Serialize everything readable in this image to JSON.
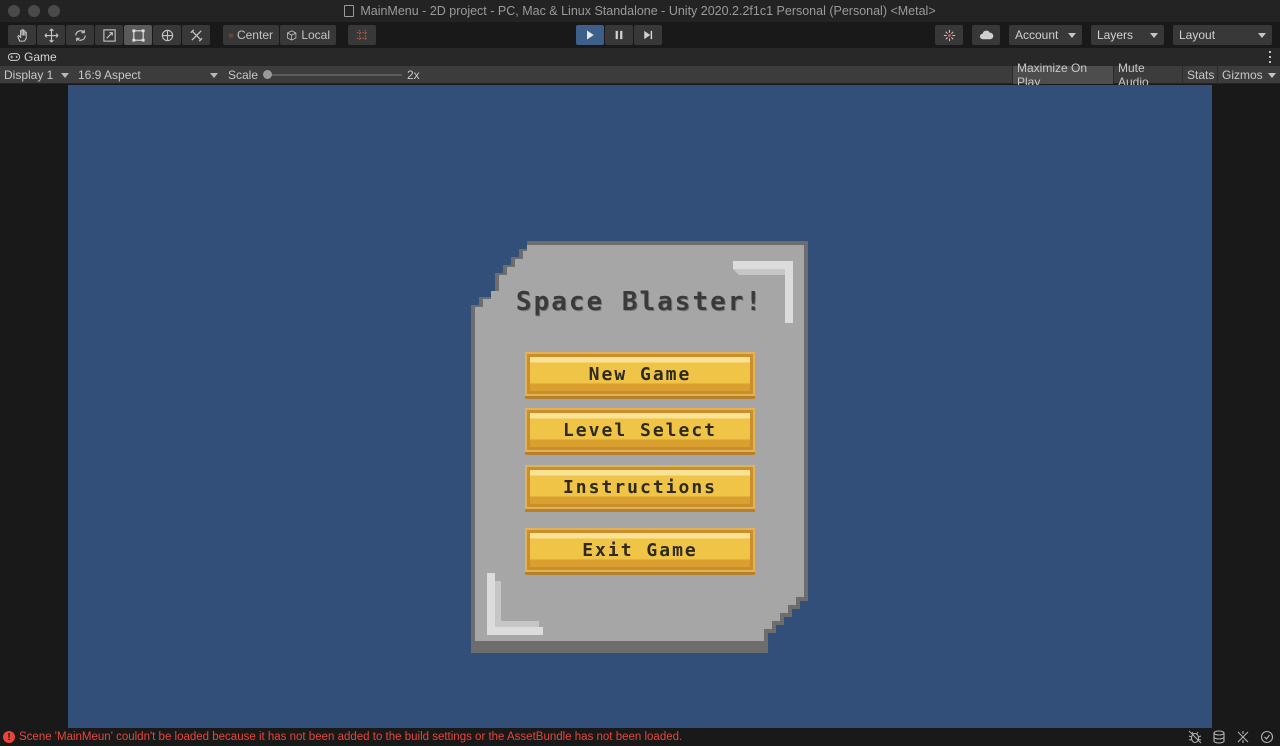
{
  "window": {
    "title": "MainMenu - 2D project - PC, Mac & Linux Standalone - Unity 2020.2.2f1c1 Personal (Personal) <Metal>"
  },
  "toolbar": {
    "tools": [
      "hand-tool",
      "move-tool",
      "rotate-tool",
      "scale-tool",
      "rect-tool",
      "transform-tool",
      "custom-tool"
    ],
    "active_tool": "rect-tool",
    "pivot_label": "Center",
    "space_label": "Local",
    "account_label": "Account",
    "layers_label": "Layers",
    "layout_label": "Layout"
  },
  "game_tab": {
    "label": "Game"
  },
  "game_controls": {
    "display": "Display 1",
    "aspect": "16:9 Aspect",
    "scale_label": "Scale",
    "scale_value": "2x",
    "maximize": "Maximize On Play",
    "mute": "Mute Audio",
    "stats": "Stats",
    "gizmos": "Gizmos"
  },
  "game": {
    "title": "Space Blaster!",
    "buttons": [
      "New Game",
      "Level Select",
      "Instructions",
      "Exit Game"
    ]
  },
  "status": {
    "message": "Scene 'MainMeun' couldn't be loaded because it has not been added to the build settings or the AssetBundle has not been loaded."
  },
  "colors": {
    "game_background": "#324f7a",
    "panel": "#a6a6a6",
    "button": "#f0c447",
    "error": "#e5463c"
  }
}
